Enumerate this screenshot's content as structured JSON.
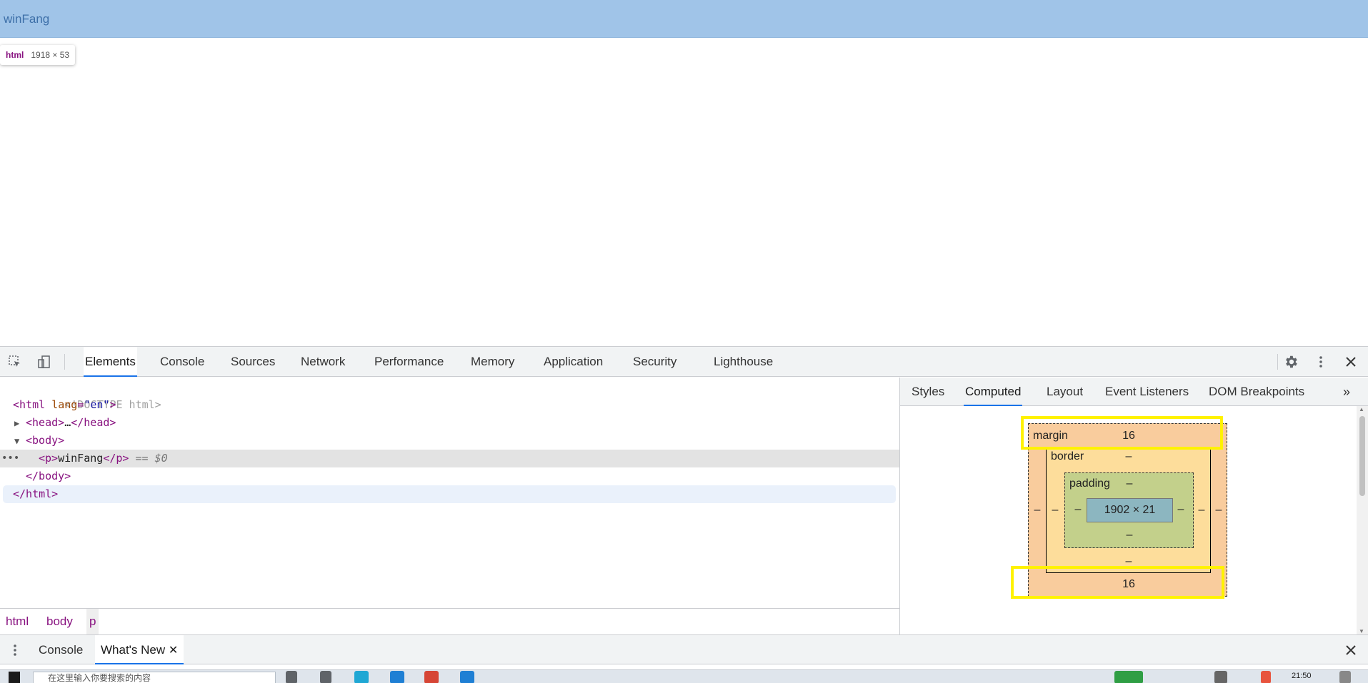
{
  "page": {
    "paragraph_text": "winFang",
    "tooltip_tag": "html",
    "tooltip_size": "1918 × 53"
  },
  "toolbar": {
    "tabs": [
      "Elements",
      "Console",
      "Sources",
      "Network",
      "Performance",
      "Memory",
      "Application",
      "Security",
      "Lighthouse"
    ],
    "active_tab": "Elements"
  },
  "dom": {
    "doctype": "<!DOCTYPE html>",
    "html_open_tag": "<html",
    "html_lang_attr": "lang",
    "html_lang_val": "\"en\"",
    "head_open": "<head>",
    "ellipsis": "…",
    "head_close": "</head>",
    "body_open": "<body>",
    "p_open": "<p>",
    "p_text": "winFang",
    "p_close": "</p>",
    "selected_marker": "== $0",
    "body_close": "</body>",
    "html_close": "</html>"
  },
  "breadcrumb": [
    "html",
    "body",
    "p"
  ],
  "side": {
    "tabs": [
      "Styles",
      "Computed",
      "Layout",
      "Event Listeners",
      "DOM Breakpoints"
    ],
    "active_tab": "Computed",
    "more_label": "»"
  },
  "box_model": {
    "margin_label": "margin",
    "margin_top": "16",
    "margin_bottom": "16",
    "margin_left": "–",
    "margin_right": "–",
    "border_label": "border",
    "border_top": "–",
    "border_bottom": "–",
    "border_left": "–",
    "border_right": "–",
    "padding_label": "padding",
    "padding_top": "–",
    "padding_bottom": "–",
    "padding_left": "–",
    "padding_right": "–",
    "content_size": "1902 × 21"
  },
  "drawer": {
    "tabs": [
      "Console",
      "What's New"
    ],
    "active_tab": "What's New"
  },
  "taskbar": {
    "search_placeholder": "在这里输入你要搜索的内容",
    "time": "21:50"
  },
  "colors": {
    "accent": "#1a73e8",
    "highlight": "#fff200",
    "paragraph_bg": "#a0c4e8"
  }
}
